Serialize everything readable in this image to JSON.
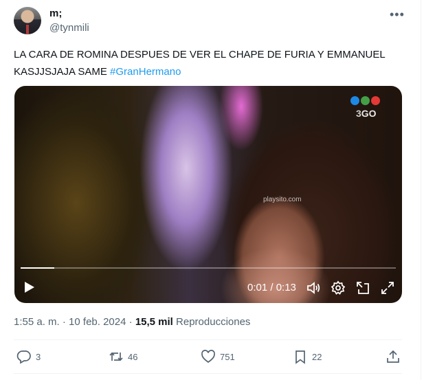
{
  "author": {
    "name": "m;",
    "handle": "@tynmili"
  },
  "tweet": {
    "text": "LA CARA DE ROMINA DESPUES DE VER EL CHAPE DE FURIA Y EMMANUEL KASJJSJAJA SAME ",
    "hashtag": "#GranHermano"
  },
  "video": {
    "channel_logo_text": "GO",
    "watermark": "playsito.com",
    "time_display": "0:01 / 0:13",
    "progress": 0.09,
    "logo_colors": [
      "#1e88e5",
      "#43a047",
      "#e53935"
    ]
  },
  "meta": {
    "time": "1:55 a. m.",
    "separator": "·",
    "date": "10 feb. 2024",
    "views_count": "15,5 mil",
    "views_label": "Reproducciones"
  },
  "actions": {
    "replies": "3",
    "retweets": "46",
    "likes": "751",
    "bookmarks": "22"
  },
  "icons": [
    "more-icon",
    "play-icon",
    "volume-icon",
    "settings-icon",
    "pip-icon",
    "fullscreen-icon",
    "reply-icon",
    "retweet-icon",
    "like-icon",
    "bookmark-icon",
    "share-icon"
  ]
}
